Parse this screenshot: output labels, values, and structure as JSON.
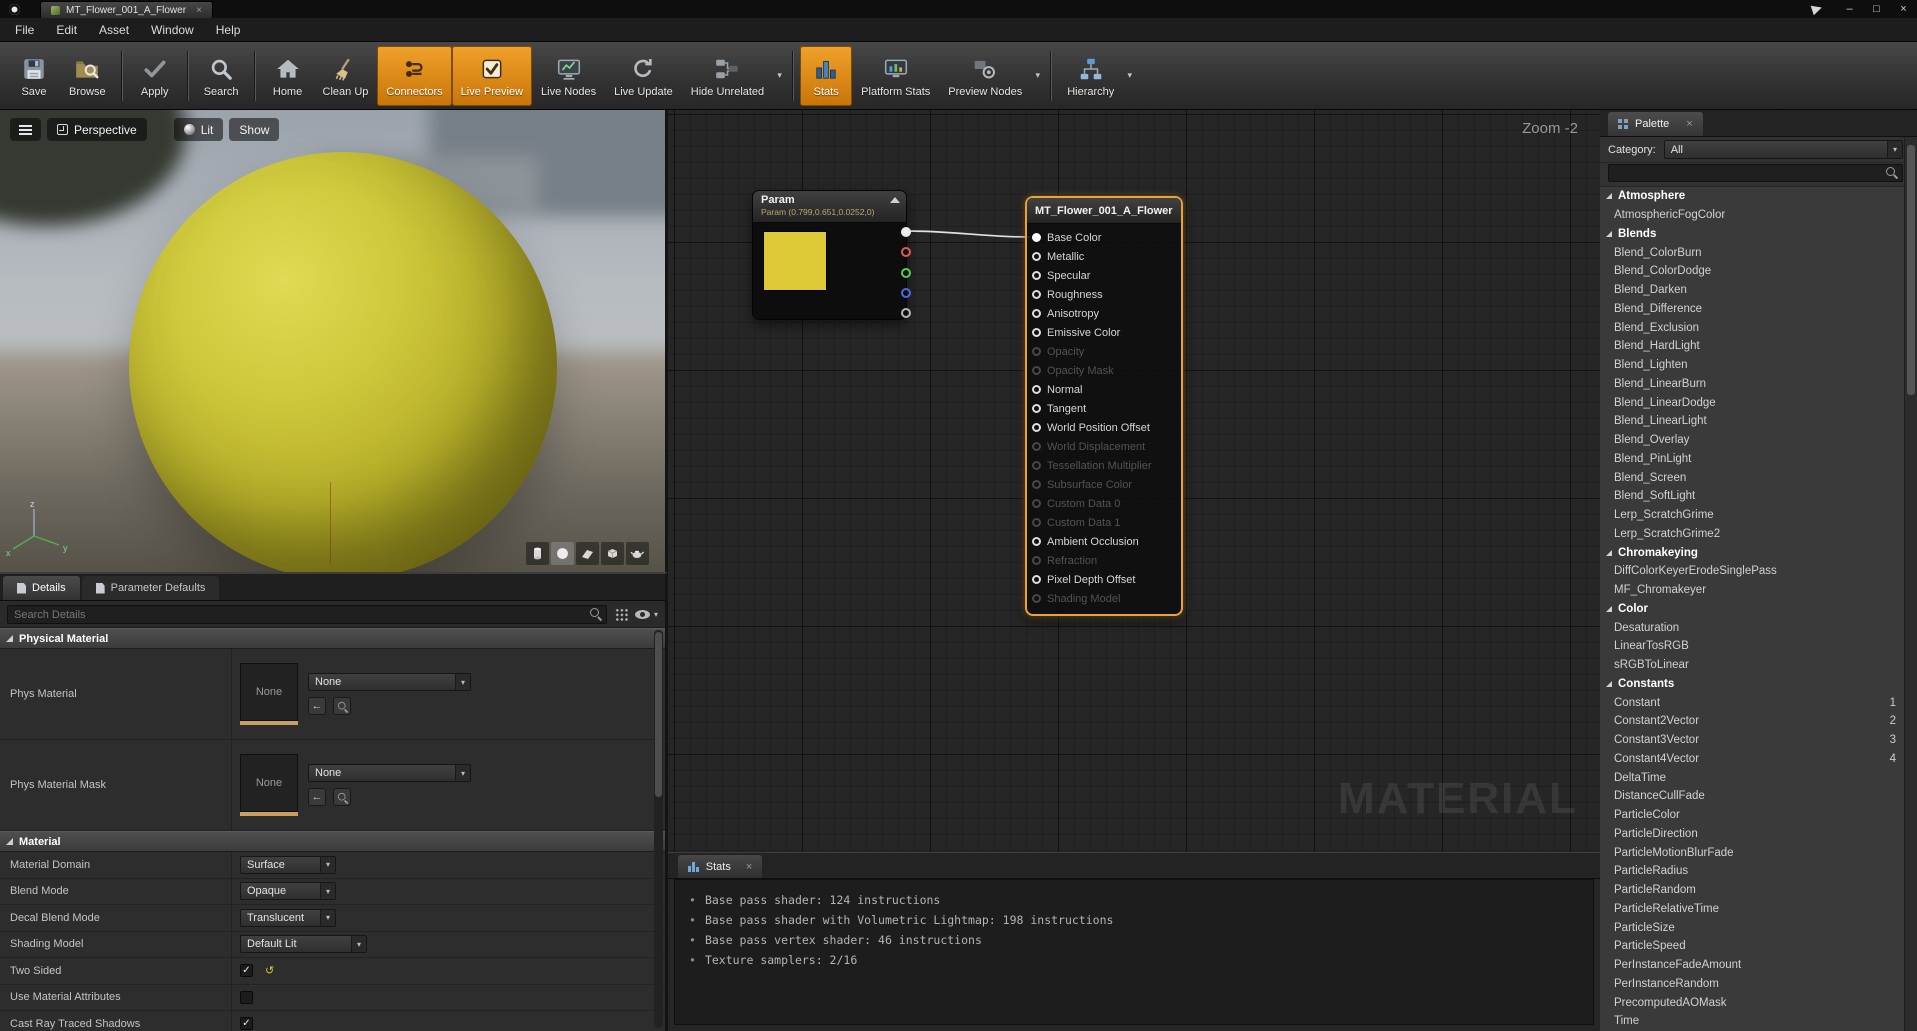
{
  "icons": {
    "caret_down": "▾",
    "close": "×",
    "bullet": "•",
    "check": "✓",
    "reset_arrow": "↺",
    "back_arrow": "←"
  },
  "titlebar": {
    "tab_title": "MT_Flower_001_A_Flower",
    "window_buttons": [
      {
        "name": "minimize",
        "glyph": "–"
      },
      {
        "name": "maximize",
        "glyph": "□"
      },
      {
        "name": "close",
        "glyph": "×"
      }
    ]
  },
  "menubar": {
    "items": [
      "File",
      "Edit",
      "Asset",
      "Window",
      "Help"
    ]
  },
  "toolbar": {
    "buttons": [
      {
        "label": "Save",
        "icon": "save"
      },
      {
        "label": "Browse",
        "icon": "browse"
      },
      {
        "label": "Apply",
        "icon": "apply",
        "sep_before": true
      },
      {
        "label": "Search",
        "icon": "search",
        "sep_before": true
      },
      {
        "label": "Home",
        "icon": "home",
        "sep_before": true
      },
      {
        "label": "Clean Up",
        "icon": "cleanup"
      },
      {
        "label": "Connectors",
        "icon": "connectors",
        "active": true
      },
      {
        "label": "Live Preview",
        "icon": "livepreview",
        "active": true
      },
      {
        "label": "Live Nodes",
        "icon": "livenodes"
      },
      {
        "label": "Live Update",
        "icon": "liveupdate"
      },
      {
        "label": "Hide Unrelated",
        "icon": "hideunrelated",
        "caret": true
      },
      {
        "label": "Stats",
        "icon": "stats",
        "active": true,
        "sep_before": true
      },
      {
        "label": "Platform Stats",
        "icon": "platformstats"
      },
      {
        "label": "Preview Nodes",
        "icon": "previewnodes",
        "caret": true
      },
      {
        "label": "Hierarchy",
        "icon": "hierarchy",
        "caret": true,
        "sep_before": true
      }
    ]
  },
  "viewport": {
    "buttons": {
      "perspective": "Perspective",
      "lit": "Lit",
      "show": "Show"
    },
    "gizmo": {
      "x": "x",
      "y": "y",
      "z": "z"
    }
  },
  "details": {
    "tabs": [
      {
        "label": "Details"
      },
      {
        "label": "Parameter Defaults"
      }
    ],
    "search_placeholder": "Search Details",
    "physical": {
      "header": "Physical Material",
      "rows": [
        {
          "label": "Phys Material",
          "thumb_label": "None",
          "value": "None"
        },
        {
          "label": "Phys Material Mask",
          "thumb_label": "None",
          "value": "None"
        }
      ]
    },
    "material": {
      "header": "Material",
      "dropdowns": [
        {
          "label": "Material Domain",
          "value": "Surface"
        },
        {
          "label": "Blend Mode",
          "value": "Opaque"
        },
        {
          "label": "Decal Blend Mode",
          "value": "Translucent"
        },
        {
          "label": "Shading Model",
          "value": "Default Lit"
        }
      ],
      "checkboxes": [
        {
          "label": "Two Sided",
          "checked": true,
          "reset": true
        },
        {
          "label": "Use Material Attributes",
          "checked": false
        },
        {
          "label": "Cast Ray Traced Shadows",
          "checked": true
        }
      ]
    }
  },
  "graph": {
    "zoom_label": "Zoom -2",
    "watermark": "MATERIAL",
    "param_node": {
      "title": "Param",
      "subtitle": "Param (0.799,0.651,0.0252,0)",
      "swatch_color": "#ddc935",
      "pins": [
        {
          "name": "output-rgba",
          "color": "#ececec",
          "connected": true
        },
        {
          "name": "output-r",
          "color": "#e05a5a"
        },
        {
          "name": "output-g",
          "color": "#52d052"
        },
        {
          "name": "output-b",
          "color": "#5268e0"
        },
        {
          "name": "output-a",
          "color": "#b8b8b8"
        }
      ]
    },
    "material_node": {
      "title": "MT_Flower_001_A_Flower",
      "pins": [
        {
          "label": "Base Color",
          "state": "connected"
        },
        {
          "label": "Metallic",
          "state": "enabled"
        },
        {
          "label": "Specular",
          "state": "enabled"
        },
        {
          "label": "Roughness",
          "state": "enabled"
        },
        {
          "label": "Anisotropy",
          "state": "enabled"
        },
        {
          "label": "Emissive Color",
          "state": "enabled"
        },
        {
          "label": "Opacity",
          "state": "disabled"
        },
        {
          "label": "Opacity Mask",
          "state": "disabled"
        },
        {
          "label": "Normal",
          "state": "enabled"
        },
        {
          "label": "Tangent",
          "state": "enabled"
        },
        {
          "label": "World Position Offset",
          "state": "enabled"
        },
        {
          "label": "World Displacement",
          "state": "disabled"
        },
        {
          "label": "Tessellation Multiplier",
          "state": "disabled"
        },
        {
          "label": "Subsurface Color",
          "state": "disabled"
        },
        {
          "label": "Custom Data 0",
          "state": "disabled"
        },
        {
          "label": "Custom Data 1",
          "state": "disabled"
        },
        {
          "label": "Ambient Occlusion",
          "state": "enabled"
        },
        {
          "label": "Refraction",
          "state": "disabled"
        },
        {
          "label": "Pixel Depth Offset",
          "state": "enabled"
        },
        {
          "label": "Shading Model",
          "state": "disabled"
        }
      ]
    }
  },
  "stats_panel": {
    "tab_label": "Stats",
    "lines": [
      "Base pass shader: 124 instructions",
      "Base pass shader with Volumetric Lightmap: 198 instructions",
      "Base pass vertex shader: 46 instructions",
      "Texture samplers: 2/16"
    ]
  },
  "palette": {
    "tab_label": "Palette",
    "category_label": "Category:",
    "category_value": "All",
    "rows": [
      {
        "type": "group",
        "label": "Atmosphere"
      },
      {
        "type": "item",
        "label": "AtmosphericFogColor"
      },
      {
        "type": "group",
        "label": "Blends"
      },
      {
        "type": "item",
        "label": "Blend_ColorBurn"
      },
      {
        "type": "item",
        "label": "Blend_ColorDodge"
      },
      {
        "type": "item",
        "label": "Blend_Darken"
      },
      {
        "type": "item",
        "label": "Blend_Difference"
      },
      {
        "type": "item",
        "label": "Blend_Exclusion"
      },
      {
        "type": "item",
        "label": "Blend_HardLight"
      },
      {
        "type": "item",
        "label": "Blend_Lighten"
      },
      {
        "type": "item",
        "label": "Blend_LinearBurn"
      },
      {
        "type": "item",
        "label": "Blend_LinearDodge"
      },
      {
        "type": "item",
        "label": "Blend_LinearLight"
      },
      {
        "type": "item",
        "label": "Blend_Overlay"
      },
      {
        "type": "item",
        "label": "Blend_PinLight"
      },
      {
        "type": "item",
        "label": "Blend_Screen"
      },
      {
        "type": "item",
        "label": "Blend_SoftLight"
      },
      {
        "type": "item",
        "label": "Lerp_ScratchGrime"
      },
      {
        "type": "item",
        "label": "Lerp_ScratchGrime2"
      },
      {
        "type": "group",
        "label": "Chromakeying"
      },
      {
        "type": "item",
        "label": "DiffColorKeyerErodeSinglePass"
      },
      {
        "type": "item",
        "label": "MF_Chromakeyer"
      },
      {
        "type": "group",
        "label": "Color"
      },
      {
        "type": "item",
        "label": "Desaturation"
      },
      {
        "type": "item",
        "label": "LinearTosRGB"
      },
      {
        "type": "item",
        "label": "sRGBToLinear"
      },
      {
        "type": "group",
        "label": "Constants"
      },
      {
        "type": "item",
        "label": "Constant",
        "shortcut": "1"
      },
      {
        "type": "item",
        "label": "Constant2Vector",
        "shortcut": "2"
      },
      {
        "type": "item",
        "label": "Constant3Vector",
        "shortcut": "3"
      },
      {
        "type": "item",
        "label": "Constant4Vector",
        "shortcut": "4"
      },
      {
        "type": "item",
        "label": "DeltaTime"
      },
      {
        "type": "item",
        "label": "DistanceCullFade"
      },
      {
        "type": "item",
        "label": "ParticleColor"
      },
      {
        "type": "item",
        "label": "ParticleDirection"
      },
      {
        "type": "item",
        "label": "ParticleMotionBlurFade"
      },
      {
        "type": "item",
        "label": "ParticleRadius"
      },
      {
        "type": "item",
        "label": "ParticleRandom"
      },
      {
        "type": "item",
        "label": "ParticleRelativeTime"
      },
      {
        "type": "item",
        "label": "ParticleSize"
      },
      {
        "type": "item",
        "label": "ParticleSpeed"
      },
      {
        "type": "item",
        "label": "PerInstanceFadeAmount"
      },
      {
        "type": "item",
        "label": "PerInstanceRandom"
      },
      {
        "type": "item",
        "label": "PrecomputedAOMask"
      },
      {
        "type": "item",
        "label": "Time"
      }
    ]
  },
  "colors": {
    "accent_orange": "#d98309",
    "selection_orange": "#e8a33a",
    "sphere_yellow": "#cfc93c"
  }
}
